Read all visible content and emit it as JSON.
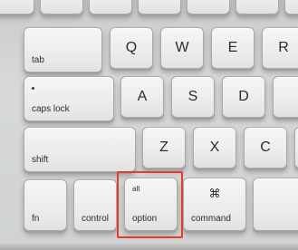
{
  "keyboard": {
    "row_top": {
      "partial_keys": [
        "",
        "",
        "",
        "",
        "",
        ""
      ]
    },
    "row_qwer": {
      "tab": "tab",
      "q": "Q",
      "w": "W",
      "e": "E",
      "r": "R"
    },
    "row_asdf": {
      "caps_lock": "caps lock",
      "a": "A",
      "s": "S",
      "d": "D"
    },
    "row_zxc": {
      "shift": "shift",
      "z": "Z",
      "x": "X",
      "c": "C"
    },
    "row_bottom": {
      "fn": "fn",
      "control": "control",
      "option_alt": "alt",
      "option": "option",
      "command_symbol": "⌘",
      "command": "command"
    }
  },
  "highlight": {
    "target": "option",
    "color": "#e53a2c"
  }
}
